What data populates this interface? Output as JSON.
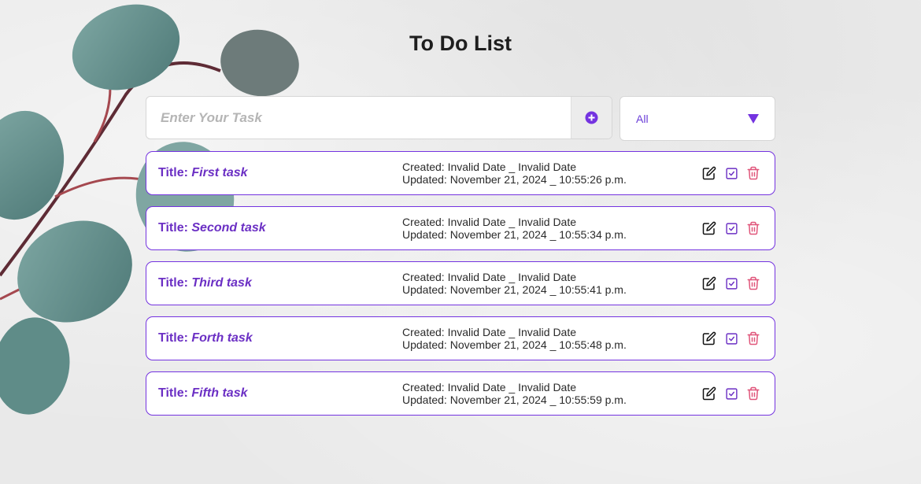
{
  "header": {
    "title": "To Do List"
  },
  "input": {
    "placeholder": "Enter Your Task",
    "value": ""
  },
  "filter": {
    "selected": "All"
  },
  "labels": {
    "title_prefix": "Title: ",
    "created_prefix": "Created: ",
    "updated_prefix": "Updated: "
  },
  "icons": {
    "add": "plus-circle-icon",
    "dropdown": "triangle-down-icon",
    "edit": "edit-icon",
    "complete": "check-square-icon",
    "delete": "trash-icon"
  },
  "colors": {
    "accent": "#6b2fc4",
    "border": "#7433e0",
    "delete": "#e0557a"
  },
  "tasks": [
    {
      "name": "First task",
      "created": "Invalid Date _ Invalid Date",
      "updated": "November 21, 2024 _ 10:55:26 p.m."
    },
    {
      "name": "Second task",
      "created": "Invalid Date _ Invalid Date",
      "updated": "November 21, 2024 _ 10:55:34 p.m."
    },
    {
      "name": "Third task",
      "created": "Invalid Date _ Invalid Date",
      "updated": "November 21, 2024 _ 10:55:41 p.m."
    },
    {
      "name": "Forth task",
      "created": "Invalid Date _ Invalid Date",
      "updated": "November 21, 2024 _ 10:55:48 p.m."
    },
    {
      "name": "Fifth task",
      "created": "Invalid Date _ Invalid Date",
      "updated": "November 21, 2024 _ 10:55:59 p.m."
    }
  ]
}
